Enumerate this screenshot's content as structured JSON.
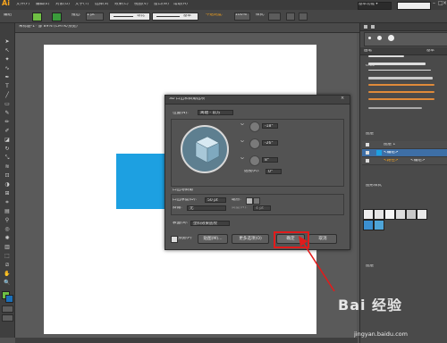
{
  "menubar": {
    "logo": "Ai",
    "items": [
      "文件(F)",
      "编辑(E)",
      "对象(O)",
      "文字(T)",
      "选择(S)",
      "效果(C)",
      "视图(V)",
      "窗口(W)",
      "帮助(H)"
    ],
    "workspace": "基本功能 ▾"
  },
  "controlbar": {
    "group_label": "编组",
    "stroke_label": "描边:",
    "stroke_value": "1 pt",
    "profile_label": "等比",
    "brush_label": "基本",
    "opacity_label": "不透明度:",
    "opacity_value": "100%",
    "style_label": "样式:"
  },
  "document": {
    "tab_title": "未标题-1* @ 89% (CMYK/预览)"
  },
  "dialog": {
    "title": "3D 凸出和斜角选项",
    "position_label": "位置(N):",
    "position_value": "离轴 - 前方",
    "rot_x": "-18°",
    "rot_y": "-26°",
    "rot_z": "8°",
    "perspective_label": "透视(R):",
    "perspective_value": "0°",
    "extrude_section": "凸出与斜角",
    "extrude_depth_label": "凸出厚度(D):",
    "extrude_depth_value": "50 pt",
    "cap_label": "端点:",
    "bevel_label": "斜角:",
    "bevel_value": "无",
    "height_label": "高度(H):",
    "height_value": "4 pt",
    "surface_label": "表面(S):",
    "surface_value": "塑料效果底纹",
    "preview_label": "预览(P)",
    "map_button": "贴图(M)...",
    "more_button": "更多选项(O)",
    "ok_button": "确定",
    "cancel_button": "取消"
  },
  "panels": {
    "brush_tab": "画笔",
    "brush_size_label": "6.00",
    "brush_basic": "基本",
    "layers_tab": "图层",
    "layer_names": [
      "图层 1",
      "<编组>",
      "<路径>",
      "<编组>"
    ],
    "swatch_tab": "图形样式",
    "bottom_tab": "图层"
  },
  "watermark": {
    "text": "Bai 经验",
    "url": "jingyan.baidu.com"
  },
  "colors": {
    "accent_blue": "#1da0e1",
    "highlight_red": "#e21b1b",
    "ai_orange": "#f7a41d"
  }
}
